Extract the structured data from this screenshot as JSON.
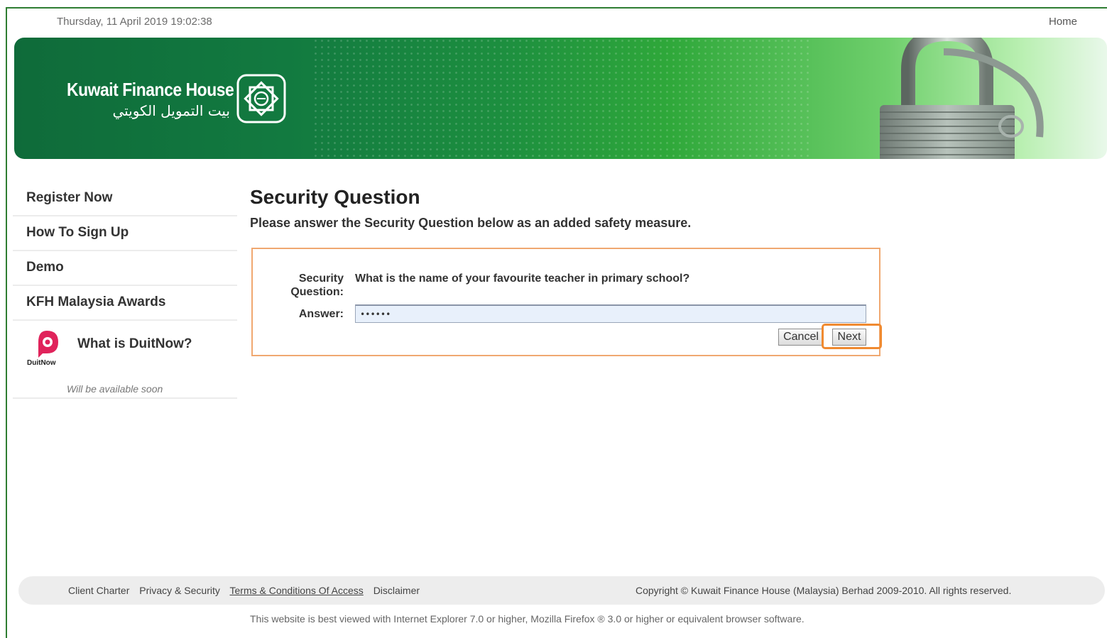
{
  "header": {
    "datetime": "Thursday, 11 April 2019 19:02:38",
    "home_link": "Home"
  },
  "banner": {
    "brand_en": "Kuwait Finance House",
    "brand_ar": "بيت التمويل الكويتي",
    "emblem_icon": "kfh-emblem-icon",
    "image_icon": "padlock-icon"
  },
  "sidebar": {
    "items": [
      {
        "label": "Register Now"
      },
      {
        "label": "How To Sign Up"
      },
      {
        "label": "Demo"
      },
      {
        "label": "KFH Malaysia Awards"
      }
    ],
    "duitnow": {
      "title": "What is DuitNow?",
      "logo_text": "DuitNow",
      "note": "Will be available soon"
    }
  },
  "main": {
    "title": "Security Question",
    "description": "Please answer the Security Question below as an added safety measure.",
    "question_label": "Security Question:",
    "question_text": "What is the name of your favourite teacher in primary school?",
    "answer_label": "Answer:",
    "answer_value": "••••••",
    "cancel_label": "Cancel",
    "next_label": "Next"
  },
  "footer": {
    "links": [
      "Client Charter",
      "Privacy & Security",
      "Terms & Conditions Of Access",
      "Disclaimer"
    ],
    "copyright": "Copyright © Kuwait Finance House (Malaysia) Berhad 2009-2010. All rights reserved.",
    "browser_note": "This website is best viewed with Internet Explorer 7.0 or higher, Mozilla Firefox ® 3.0 or higher or equivalent browser software."
  },
  "colors": {
    "brand_green": "#127a40",
    "highlight_orange": "#f08a30",
    "box_border": "#f0a870",
    "duitnow_pink": "#e0235b"
  }
}
